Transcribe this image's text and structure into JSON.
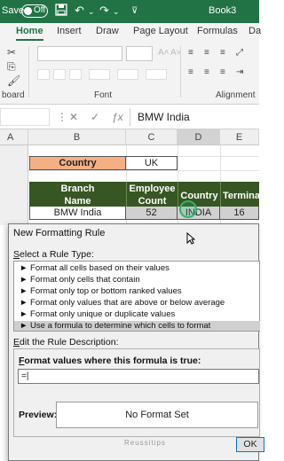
{
  "titlebar": {
    "autosave_label": "Save",
    "toggle_state": "Off",
    "book_name": "Book3",
    "icons": [
      "save-icon",
      "undo-icon",
      "redo-icon",
      "customize-icon"
    ]
  },
  "ribbon": {
    "tabs": [
      {
        "label": "Home",
        "active": true
      },
      {
        "label": "Insert"
      },
      {
        "label": "Draw"
      },
      {
        "label": "Page Layout"
      },
      {
        "label": "Formulas"
      },
      {
        "label": "Da"
      }
    ],
    "groups": {
      "clipboard": "board",
      "font": "Font",
      "alignment": "Alignment"
    }
  },
  "formula_bar": {
    "cancel_icon": "close-icon",
    "enter_icon": "check-icon",
    "function_icon": "fx-icon",
    "content": "BMW India"
  },
  "grid": {
    "columns": [
      "A",
      "B",
      "C",
      "D",
      "E"
    ],
    "country_label": "Country",
    "country_value": "UK",
    "headers": {
      "branch_line1": "Branch",
      "branch_line2": "Name",
      "employee_line1": "Employee",
      "employee_line2": "Count",
      "country": "Country",
      "termination": "Terminatio"
    },
    "row": {
      "branch": "BMW India",
      "employee": "52",
      "country": "INDIA",
      "termination": "16"
    }
  },
  "dialog": {
    "title": "New Formatting Rule",
    "select_type_label_u": "S",
    "select_type_label_rest": "elect a Rule Type:",
    "rule_types": [
      "Format all cells based on their values",
      "Format only cells that contain",
      "Format only top or bottom ranked values",
      "Format only values that are above or below average",
      "Format only unique or duplicate values",
      "Use a formula to determine which cells to format"
    ],
    "selected_rule_index": 5,
    "edit_label_u": "E",
    "edit_label_rest": "dit the Rule Description:",
    "formula_label_pre": "F",
    "formula_label_rest": "ormat values where this formula is true:",
    "formula_value": "=|",
    "preview_label": "Preview:",
    "preview_text": "No Format Set",
    "watermark": "Reussitips",
    "ok_label": "OK"
  },
  "colors": {
    "excel_green": "#217346",
    "header_green": "#375623",
    "country_orange": "#f4b084",
    "focus_blue": "#0078d4"
  }
}
